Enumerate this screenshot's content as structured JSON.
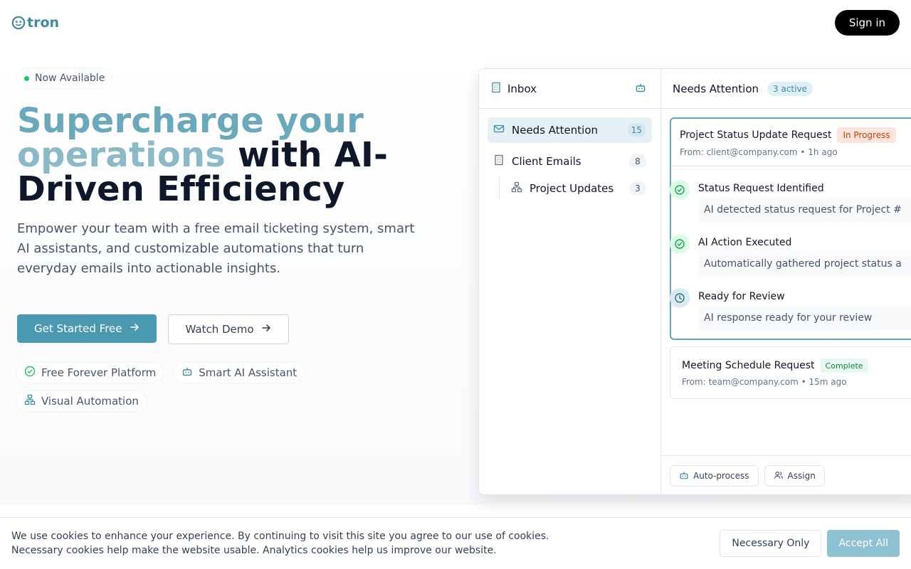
{
  "header": {
    "logo_text": "tron",
    "signin_label": "Sign in"
  },
  "hero": {
    "badge": "Now Available",
    "title_part1": "Supercharge your",
    "title_part2": "operations",
    "title_part3": "with AI-",
    "title_part4": "Driven Efficiency",
    "lead": "Empower your team with a free email ticketing system, smart AI assistants, and customizable automations that turn everyday emails into actionable insights.",
    "cta_primary": "Get Started Free",
    "cta_secondary": "Watch Demo",
    "features": [
      "Free Forever Platform",
      "Smart AI Assistant",
      "Visual Automation"
    ]
  },
  "app": {
    "sidebar": {
      "title": "Inbox",
      "items": [
        {
          "label": "Needs Attention",
          "count": "15"
        },
        {
          "label": "Client Emails",
          "count": "8"
        },
        {
          "label": "Project Updates",
          "count": "3"
        }
      ]
    },
    "main": {
      "title": "Needs Attention",
      "active_badge": "3 active",
      "card1": {
        "title": "Project Status Update Request",
        "status": "In Progress",
        "from": "From: client@company.com • 1h ago",
        "steps": [
          {
            "title": "Status Request Identified",
            "desc": "AI detected status request for Project #"
          },
          {
            "title": "AI Action Executed",
            "desc": "Automatically gathered project status a"
          },
          {
            "title": "Ready for Review",
            "desc": "AI response ready for your review"
          }
        ]
      },
      "card2": {
        "title": "Meeting Schedule Request",
        "status": "Complete",
        "from": "From: team@company.com • 15m ago"
      },
      "footer": {
        "autoprocess_label": "Auto-process",
        "assign_label": "Assign"
      }
    }
  },
  "cookie": {
    "line1": "We use cookies to enhance your experience. By continuing to visit this site you agree to our use of cookies.",
    "line2": "Necessary cookies help make the website usable. Analytics cookies help us improve our website.",
    "necessary_label": "Necessary Only",
    "accept_label": "Accept All"
  },
  "colors": {
    "brand": "#4a99b0",
    "accent_light": "#8ec1d1",
    "status_progress": "#c2410c",
    "status_complete": "#15803d"
  }
}
